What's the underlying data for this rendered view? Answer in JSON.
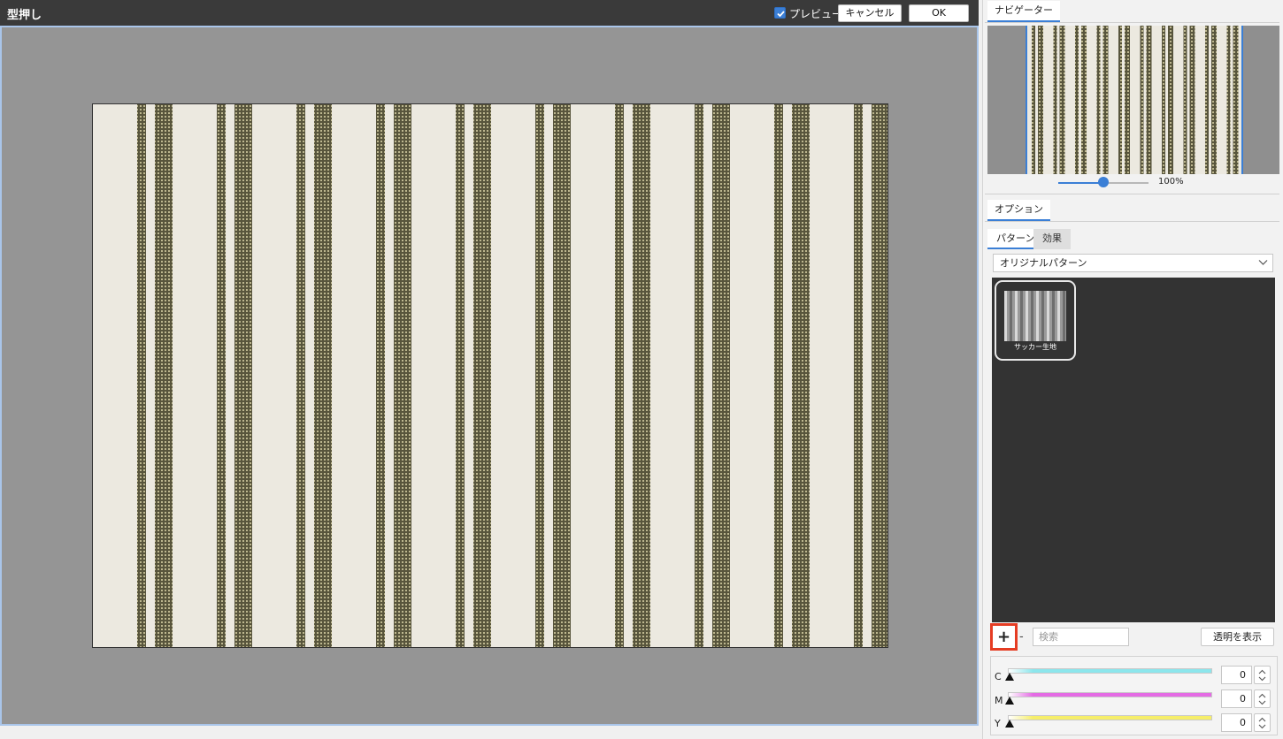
{
  "dialog": {
    "title": "型押し",
    "preview_label": "プレビュー",
    "preview_checked": true,
    "cancel_label": "キャンセル",
    "ok_label": "OK"
  },
  "navigator": {
    "tab_label": "ナビゲーター",
    "zoom_text": "100%",
    "zoom_level": 0.5
  },
  "options": {
    "tab_label": "オプション",
    "subtabs": [
      "パターン",
      "効果"
    ],
    "active_subtab": "パターン",
    "pattern_category": "オリジナルパターン",
    "patterns": [
      {
        "name": "サッカー生地",
        "selected": true
      }
    ],
    "add_label": "+",
    "remove_label": "-",
    "search_placeholder": "検索",
    "transparent_button_label": "透明を表示"
  },
  "color_adjust": {
    "channels": [
      {
        "label": "C",
        "value": "0",
        "color": "#8ce6ec"
      },
      {
        "label": "M",
        "value": "0",
        "color": "#e46be4"
      },
      {
        "label": "Y",
        "value": "0",
        "color": "#f6ee6a"
      }
    ]
  },
  "colors": {
    "accent": "#3b7fd6",
    "highlight": "#e53c23",
    "fabric_base": "#ece9e0",
    "stripe_dark": "#58553c"
  },
  "icons": {
    "check": "check-icon",
    "dropdown": "chevron-down-icon",
    "spinner": "spinner-icon"
  }
}
